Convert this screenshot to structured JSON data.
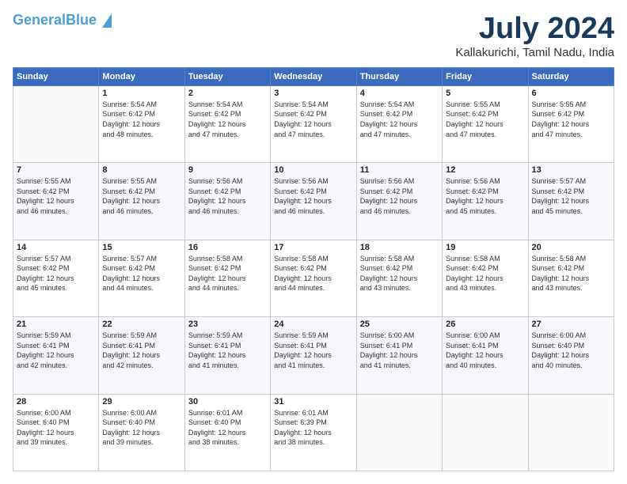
{
  "logo": {
    "line1": "General",
    "line2": "Blue",
    "tagline": ""
  },
  "header": {
    "month_year": "July 2024",
    "location": "Kallakurichi, Tamil Nadu, India"
  },
  "weekdays": [
    "Sunday",
    "Monday",
    "Tuesday",
    "Wednesday",
    "Thursday",
    "Friday",
    "Saturday"
  ],
  "weeks": [
    [
      {
        "day": "",
        "info": ""
      },
      {
        "day": "1",
        "info": "Sunrise: 5:54 AM\nSunset: 6:42 PM\nDaylight: 12 hours\nand 48 minutes."
      },
      {
        "day": "2",
        "info": "Sunrise: 5:54 AM\nSunset: 6:42 PM\nDaylight: 12 hours\nand 47 minutes."
      },
      {
        "day": "3",
        "info": "Sunrise: 5:54 AM\nSunset: 6:42 PM\nDaylight: 12 hours\nand 47 minutes."
      },
      {
        "day": "4",
        "info": "Sunrise: 5:54 AM\nSunset: 6:42 PM\nDaylight: 12 hours\nand 47 minutes."
      },
      {
        "day": "5",
        "info": "Sunrise: 5:55 AM\nSunset: 6:42 PM\nDaylight: 12 hours\nand 47 minutes."
      },
      {
        "day": "6",
        "info": "Sunrise: 5:55 AM\nSunset: 6:42 PM\nDaylight: 12 hours\nand 47 minutes."
      }
    ],
    [
      {
        "day": "7",
        "info": "Sunrise: 5:55 AM\nSunset: 6:42 PM\nDaylight: 12 hours\nand 46 minutes."
      },
      {
        "day": "8",
        "info": "Sunrise: 5:55 AM\nSunset: 6:42 PM\nDaylight: 12 hours\nand 46 minutes."
      },
      {
        "day": "9",
        "info": "Sunrise: 5:56 AM\nSunset: 6:42 PM\nDaylight: 12 hours\nand 46 minutes."
      },
      {
        "day": "10",
        "info": "Sunrise: 5:56 AM\nSunset: 6:42 PM\nDaylight: 12 hours\nand 46 minutes."
      },
      {
        "day": "11",
        "info": "Sunrise: 5:56 AM\nSunset: 6:42 PM\nDaylight: 12 hours\nand 46 minutes."
      },
      {
        "day": "12",
        "info": "Sunrise: 5:56 AM\nSunset: 6:42 PM\nDaylight: 12 hours\nand 45 minutes."
      },
      {
        "day": "13",
        "info": "Sunrise: 5:57 AM\nSunset: 6:42 PM\nDaylight: 12 hours\nand 45 minutes."
      }
    ],
    [
      {
        "day": "14",
        "info": "Sunrise: 5:57 AM\nSunset: 6:42 PM\nDaylight: 12 hours\nand 45 minutes."
      },
      {
        "day": "15",
        "info": "Sunrise: 5:57 AM\nSunset: 6:42 PM\nDaylight: 12 hours\nand 44 minutes."
      },
      {
        "day": "16",
        "info": "Sunrise: 5:58 AM\nSunset: 6:42 PM\nDaylight: 12 hours\nand 44 minutes."
      },
      {
        "day": "17",
        "info": "Sunrise: 5:58 AM\nSunset: 6:42 PM\nDaylight: 12 hours\nand 44 minutes."
      },
      {
        "day": "18",
        "info": "Sunrise: 5:58 AM\nSunset: 6:42 PM\nDaylight: 12 hours\nand 43 minutes."
      },
      {
        "day": "19",
        "info": "Sunrise: 5:58 AM\nSunset: 6:42 PM\nDaylight: 12 hours\nand 43 minutes."
      },
      {
        "day": "20",
        "info": "Sunrise: 5:58 AM\nSunset: 6:42 PM\nDaylight: 12 hours\nand 43 minutes."
      }
    ],
    [
      {
        "day": "21",
        "info": "Sunrise: 5:59 AM\nSunset: 6:41 PM\nDaylight: 12 hours\nand 42 minutes."
      },
      {
        "day": "22",
        "info": "Sunrise: 5:59 AM\nSunset: 6:41 PM\nDaylight: 12 hours\nand 42 minutes."
      },
      {
        "day": "23",
        "info": "Sunrise: 5:59 AM\nSunset: 6:41 PM\nDaylight: 12 hours\nand 41 minutes."
      },
      {
        "day": "24",
        "info": "Sunrise: 5:59 AM\nSunset: 6:41 PM\nDaylight: 12 hours\nand 41 minutes."
      },
      {
        "day": "25",
        "info": "Sunrise: 6:00 AM\nSunset: 6:41 PM\nDaylight: 12 hours\nand 41 minutes."
      },
      {
        "day": "26",
        "info": "Sunrise: 6:00 AM\nSunset: 6:41 PM\nDaylight: 12 hours\nand 40 minutes."
      },
      {
        "day": "27",
        "info": "Sunrise: 6:00 AM\nSunset: 6:40 PM\nDaylight: 12 hours\nand 40 minutes."
      }
    ],
    [
      {
        "day": "28",
        "info": "Sunrise: 6:00 AM\nSunset: 6:40 PM\nDaylight: 12 hours\nand 39 minutes."
      },
      {
        "day": "29",
        "info": "Sunrise: 6:00 AM\nSunset: 6:40 PM\nDaylight: 12 hours\nand 39 minutes."
      },
      {
        "day": "30",
        "info": "Sunrise: 6:01 AM\nSunset: 6:40 PM\nDaylight: 12 hours\nand 38 minutes."
      },
      {
        "day": "31",
        "info": "Sunrise: 6:01 AM\nSunset: 6:39 PM\nDaylight: 12 hours\nand 38 minutes."
      },
      {
        "day": "",
        "info": ""
      },
      {
        "day": "",
        "info": ""
      },
      {
        "day": "",
        "info": ""
      }
    ]
  ]
}
